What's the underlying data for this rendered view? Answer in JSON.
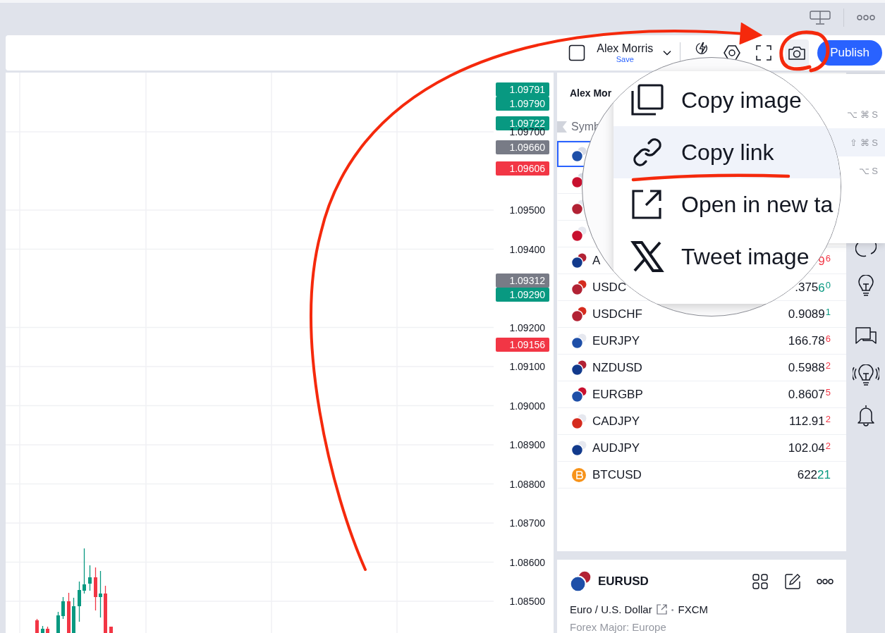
{
  "toolbar": {
    "account_name": "Alex Morris",
    "save_label": "Save",
    "publish_label": "Publish"
  },
  "price_axis": {
    "labels": [
      {
        "value": "1.09791",
        "color": "#089981"
      },
      {
        "value": "1.09790",
        "color": "#089981"
      },
      {
        "value": "1.09722",
        "color": "#089981"
      },
      {
        "value": "1.09700"
      },
      {
        "value": "1.09660",
        "color": "#787b86"
      },
      {
        "value": "1.09606",
        "color": "#f23645"
      },
      {
        "value": "1.09500"
      },
      {
        "value": "1.09400"
      },
      {
        "value": "1.09312",
        "color": "#787b86"
      },
      {
        "value": "1.09290",
        "color": "#089981"
      },
      {
        "value": "1.09200"
      },
      {
        "value": "1.09156",
        "color": "#f23645"
      },
      {
        "value": "1.09100"
      },
      {
        "value": "1.09000"
      },
      {
        "value": "1.08900"
      },
      {
        "value": "1.08800"
      },
      {
        "value": "1.08700"
      },
      {
        "value": "1.08600"
      },
      {
        "value": "1.08500"
      }
    ]
  },
  "watchlist": {
    "title": "Alex Mor",
    "column_header": "Symb",
    "rows": [
      {
        "selected": true
      },
      {
        "selected": false
      },
      {
        "selected": false
      },
      {
        "selected": false
      },
      {
        "symbol": "A",
        "change": "9",
        "pip": "6",
        "color": "#f23645",
        "kind": "fx",
        "selected": false
      },
      {
        "symbol": "USDC",
        "price": ".375",
        "change": "6",
        "pip": "0",
        "color": "#089981",
        "kind": "fx",
        "selected": false
      },
      {
        "symbol": "USDCHF",
        "price": "0.9089",
        "pip": "1",
        "color": "#089981",
        "kind": "fx",
        "selected": false
      },
      {
        "symbol": "EURJPY",
        "price": "166.78",
        "pip": "6",
        "color": "#f23645",
        "kind": "fx",
        "selected": false
      },
      {
        "symbol": "NZDUSD",
        "price": "0.5988",
        "pip": "2",
        "color": "#f23645",
        "kind": "fx",
        "selected": false
      },
      {
        "symbol": "EURGBP",
        "price": "0.8607",
        "pip": "5",
        "color": "#f23645",
        "kind": "fx",
        "selected": false
      },
      {
        "symbol": "CADJPY",
        "price": "112.91",
        "pip": "2",
        "color": "#f23645",
        "kind": "fx",
        "selected": false
      },
      {
        "symbol": "AUDJPY",
        "price": "102.04",
        "pip": "2",
        "color": "#f23645",
        "kind": "fx",
        "selected": false
      },
      {
        "symbol": "BTCUSD",
        "price": "622",
        "change": "21",
        "color": "#089981",
        "kind": "crypto",
        "selected": false
      }
    ]
  },
  "details": {
    "symbol": "EURUSD",
    "description": "Euro / U.S. Dollar",
    "separator": "•",
    "exchange": "FXCM",
    "category": "Forex Major: Europe"
  },
  "share_menu": {
    "items": [
      {
        "label": "Copy image",
        "shortcut": "⌥ ⌘ S",
        "selected": false
      },
      {
        "label": "Copy link",
        "shortcut": "⇧ ⌘ S",
        "selected": true
      },
      {
        "label": "Open in new ta",
        "shortcut": "⌥ S",
        "selected": false
      },
      {
        "label": "Tweet image",
        "selected": false
      }
    ]
  }
}
